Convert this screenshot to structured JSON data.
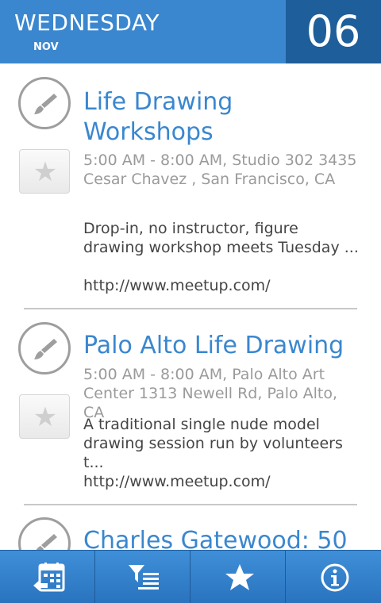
{
  "header": {
    "day_of_week": "WEDNESDAY",
    "month": "NOV",
    "day_number": "06"
  },
  "events": [
    {
      "category_icon": "paintbrush-icon",
      "title": "Life Drawing Workshops",
      "meta": "5:00 AM - 8:00 AM, Studio 302 3435 Cesar Chavez , San Francisco, CA",
      "description": "Drop-in, no instructor, figure drawing workshop meets Tuesday ...",
      "link": "http://www.meetup.com/",
      "starred": false
    },
    {
      "category_icon": "paintbrush-icon",
      "title": "Palo Alto Life Drawing",
      "meta": "5:00 AM - 8:00 AM, Palo Alto Art Center 1313 Newell Rd, Palo Alto, CA",
      "description": "A traditional single nude model drawing session run by volunteers t...",
      "link": "http://www.meetup.com/",
      "starred": false
    },
    {
      "category_icon": "paintbrush-icon",
      "title": "Charles Gatewood: 50"
    }
  ],
  "bottom_bar": {
    "tabs": [
      {
        "icon": "calendar-back-icon"
      },
      {
        "icon": "filter-list-icon"
      },
      {
        "icon": "star-icon"
      },
      {
        "icon": "info-icon"
      }
    ]
  },
  "colors": {
    "accent": "#3a87cf",
    "header_day_box": "#1e5e9a",
    "meta_text": "#9a9a9a"
  }
}
